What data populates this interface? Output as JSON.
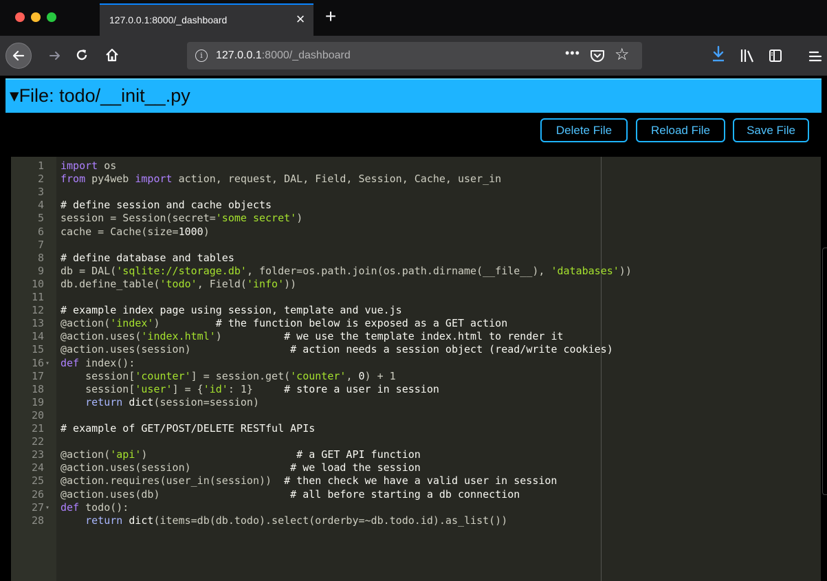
{
  "browser": {
    "tab": {
      "title": "127.0.0.1:8000/_dashboard",
      "close": "×"
    },
    "new_tab": "+",
    "url": {
      "host": "127.0.0.1",
      "rest": ":8000/_dashboard"
    },
    "url_more": "•••",
    "icons": [
      "back-icon",
      "forward-icon",
      "reload-icon",
      "home-icon",
      "info-icon",
      "page-actions-icon",
      "pocket-icon",
      "bookmark-star-icon",
      "downloads-icon",
      "library-icon",
      "sidebar-icon",
      "menu-icon"
    ],
    "colors": {
      "chrome": "#323234",
      "tabbar": "#0c0c0d",
      "accent": "#0a84ff",
      "update_badge": "#12bc00"
    }
  },
  "page": {
    "file_header": {
      "caret": "▾",
      "title": "File: todo/__init__.py"
    },
    "buttons": {
      "delete": "Delete File",
      "reload": "Reload File",
      "save": "Save File"
    },
    "colors": {
      "header": "#1eb4ff",
      "button_text": "#4fc3ff",
      "editor_bg": "#272822"
    }
  },
  "editor": {
    "lines": [
      {
        "n": "1",
        "fold": "",
        "tokens": [
          [
            "kw",
            "import"
          ],
          [
            "id",
            " os"
          ]
        ]
      },
      {
        "n": "2",
        "fold": "",
        "tokens": [
          [
            "kw",
            "from"
          ],
          [
            "id",
            " py4web "
          ],
          [
            "kw",
            "import"
          ],
          [
            "id",
            " action, request, DAL, Field, Session, Cache, user_in"
          ]
        ]
      },
      {
        "n": "3",
        "fold": "",
        "tokens": []
      },
      {
        "n": "4",
        "fold": "",
        "tokens": [
          [
            "com",
            "# define session and cache objects"
          ]
        ]
      },
      {
        "n": "5",
        "fold": "",
        "tokens": [
          [
            "id",
            "session = Session(secret="
          ],
          [
            "str",
            "'some secret'"
          ],
          [
            "id",
            ")"
          ]
        ]
      },
      {
        "n": "6",
        "fold": "",
        "tokens": [
          [
            "id",
            "cache = Cache(size="
          ],
          [
            "num",
            "1000"
          ],
          [
            "id",
            ")"
          ]
        ]
      },
      {
        "n": "7",
        "fold": "",
        "tokens": []
      },
      {
        "n": "8",
        "fold": "",
        "tokens": [
          [
            "com",
            "# define database and tables"
          ]
        ]
      },
      {
        "n": "9",
        "fold": "",
        "tokens": [
          [
            "id",
            "db = DAL("
          ],
          [
            "str",
            "'sqlite://storage.db'"
          ],
          [
            "id",
            ", folder=os.path.join(os.path.dirname(__file__), "
          ],
          [
            "str",
            "'databases'"
          ],
          [
            "id",
            "))"
          ]
        ]
      },
      {
        "n": "10",
        "fold": "",
        "tokens": [
          [
            "id",
            "db.define_table("
          ],
          [
            "str",
            "'todo'"
          ],
          [
            "id",
            ", Field("
          ],
          [
            "str",
            "'info'"
          ],
          [
            "id",
            "))"
          ]
        ]
      },
      {
        "n": "11",
        "fold": "",
        "tokens": []
      },
      {
        "n": "12",
        "fold": "",
        "tokens": [
          [
            "com",
            "# example index page using session, template and vue.js"
          ]
        ]
      },
      {
        "n": "13",
        "fold": "",
        "tokens": [
          [
            "dec",
            "@action("
          ],
          [
            "str",
            "'index'"
          ],
          [
            "dec",
            ")"
          ],
          [
            "com",
            "         # the function below is exposed as a GET action"
          ]
        ]
      },
      {
        "n": "14",
        "fold": "",
        "tokens": [
          [
            "dec",
            "@action.uses("
          ],
          [
            "str",
            "'index.html'"
          ],
          [
            "dec",
            ")"
          ],
          [
            "com",
            "          # we use the template index.html to render it"
          ]
        ]
      },
      {
        "n": "15",
        "fold": "",
        "tokens": [
          [
            "dec",
            "@action.uses(session)"
          ],
          [
            "com",
            "                # action needs a session object (read/write cookies)"
          ]
        ]
      },
      {
        "n": "16",
        "fold": "▾",
        "tokens": [
          [
            "kw",
            "def"
          ],
          [
            "id",
            " index():"
          ]
        ]
      },
      {
        "n": "17",
        "fold": "",
        "tokens": [
          [
            "id",
            "    session["
          ],
          [
            "str",
            "'counter'"
          ],
          [
            "id",
            "] = session.get("
          ],
          [
            "str",
            "'counter'"
          ],
          [
            "id",
            ", "
          ],
          [
            "num",
            "0"
          ],
          [
            "id",
            ") + 1"
          ]
        ]
      },
      {
        "n": "18",
        "fold": "",
        "tokens": [
          [
            "id",
            "    session["
          ],
          [
            "str",
            "'user'"
          ],
          [
            "id",
            "] = {"
          ],
          [
            "str",
            "'id'"
          ],
          [
            "id",
            ": 1}     "
          ],
          [
            "com",
            "# store a user in session"
          ]
        ]
      },
      {
        "n": "19",
        "fold": "",
        "tokens": [
          [
            "kw2",
            "    return"
          ],
          [
            "bi",
            " dict"
          ],
          [
            "id",
            "(session=session)"
          ]
        ]
      },
      {
        "n": "20",
        "fold": "",
        "tokens": []
      },
      {
        "n": "21",
        "fold": "",
        "tokens": [
          [
            "com",
            "# example of GET/POST/DELETE RESTful APIs"
          ]
        ]
      },
      {
        "n": "22",
        "fold": "",
        "tokens": []
      },
      {
        "n": "23",
        "fold": "",
        "tokens": [
          [
            "dec",
            "@action("
          ],
          [
            "str",
            "'api'"
          ],
          [
            "dec",
            ")"
          ],
          [
            "com",
            "                        # a GET API function"
          ]
        ]
      },
      {
        "n": "24",
        "fold": "",
        "tokens": [
          [
            "dec",
            "@action.uses(session)"
          ],
          [
            "com",
            "                # we load the session"
          ]
        ]
      },
      {
        "n": "25",
        "fold": "",
        "tokens": [
          [
            "dec",
            "@action.requires(user_in(session))"
          ],
          [
            "com",
            "  # then check we have a valid user in session"
          ]
        ]
      },
      {
        "n": "26",
        "fold": "",
        "tokens": [
          [
            "dec",
            "@action.uses(db)"
          ],
          [
            "com",
            "                     # all before starting a db connection"
          ]
        ]
      },
      {
        "n": "27",
        "fold": "▾",
        "tokens": [
          [
            "kw",
            "def"
          ],
          [
            "id",
            " todo():"
          ]
        ]
      },
      {
        "n": "28",
        "fold": "",
        "tokens": [
          [
            "kw2",
            "    return"
          ],
          [
            "bi",
            " dict"
          ],
          [
            "id",
            "(items=db(db.todo).select(orderby=~db.todo.id).as_list())"
          ]
        ]
      }
    ]
  }
}
